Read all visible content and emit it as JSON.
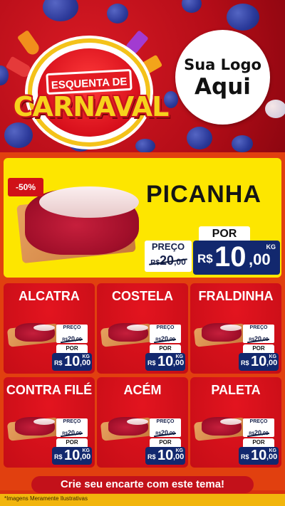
{
  "header": {
    "badge_top": "ESQUENTA DE",
    "badge_main": "CARNAVAL",
    "logo_line1": "Sua Logo",
    "logo_line2": "Aqui"
  },
  "featured": {
    "discount": "-50%",
    "name": "PICANHA",
    "preco_label": "PREÇO",
    "old_price_currency": "R$",
    "old_price_int": "20",
    "old_price_cents": ",00",
    "por_label": "POR",
    "price_currency": "R$",
    "price_int": "10",
    "price_cents": ",00",
    "unit": "KG"
  },
  "products": [
    {
      "name": "ALCATRA",
      "preco_label": "PREÇO",
      "old_price": "20",
      "old_price_currency": "R$",
      "old_price_cents": ",00",
      "por_label": "POR",
      "currency": "R$",
      "price_int": "10",
      "price_cents": ",00",
      "unit": "KG"
    },
    {
      "name": "COSTELA",
      "preco_label": "PREÇO",
      "old_price": "20",
      "old_price_currency": "R$",
      "old_price_cents": ",00",
      "por_label": "POR",
      "currency": "R$",
      "price_int": "10",
      "price_cents": ",00",
      "unit": "KG"
    },
    {
      "name": "FRALDINHA",
      "preco_label": "PREÇO",
      "old_price": "20",
      "old_price_currency": "R$",
      "old_price_cents": ",00",
      "por_label": "POR",
      "currency": "R$",
      "price_int": "10",
      "price_cents": ",00",
      "unit": "KG"
    },
    {
      "name": "CONTRA FILÉ",
      "preco_label": "PREÇO",
      "old_price": "20",
      "old_price_currency": "R$",
      "old_price_cents": ",00",
      "por_label": "POR",
      "currency": "R$",
      "price_int": "10",
      "price_cents": ",00",
      "unit": "KG"
    },
    {
      "name": "ACÉM",
      "preco_label": "PREÇO",
      "old_price": "20",
      "old_price_currency": "R$",
      "old_price_cents": ",00",
      "por_label": "POR",
      "currency": "R$",
      "price_int": "10",
      "price_cents": ",00",
      "unit": "KG"
    },
    {
      "name": "PALETA",
      "preco_label": "PREÇO",
      "old_price": "20",
      "old_price_currency": "R$",
      "old_price_cents": ",00",
      "por_label": "POR",
      "currency": "R$",
      "price_int": "10",
      "price_cents": ",00",
      "unit": "KG"
    }
  ],
  "cta": "Crie seu encarte com este tema!",
  "disclaimer": "*Imagens Meramente Ilustrativas",
  "colors": {
    "header_red": "#c8101a",
    "yellow": "#fde600",
    "card_red": "#d4101a",
    "navy": "#12286e",
    "orange": "#e1400f",
    "footer_yellow": "#f2b50d"
  }
}
